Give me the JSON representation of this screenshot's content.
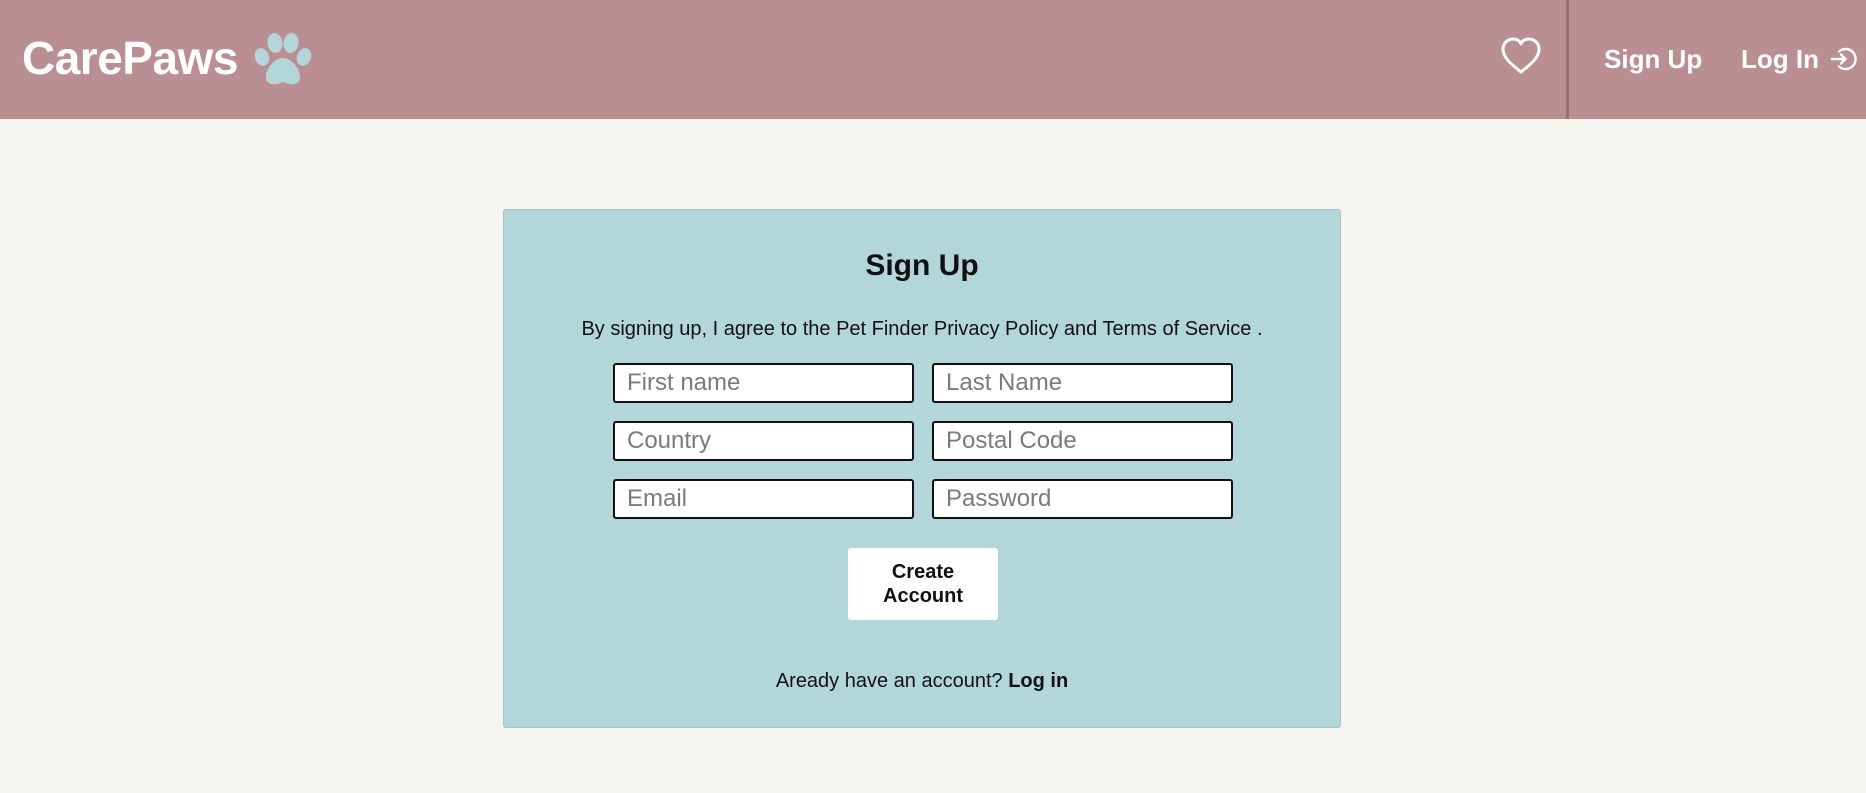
{
  "header": {
    "brand": "CarePaws",
    "nav": {
      "signup_label": "Sign Up",
      "login_label": "Log In"
    }
  },
  "icons": {
    "brand": "paw-icon",
    "favorites": "heart-icon",
    "login": "login-icon"
  },
  "colors": {
    "header_bg": "#ba8f94",
    "page_bg": "#f6f5f1",
    "card_bg": "#b3d6d8",
    "paw": "#b3d6d8"
  },
  "form": {
    "title": "Sign Up",
    "agreement": "By signing up, I agree to the Pet Finder Privacy Policy and Terms of Service .",
    "fields": {
      "first_name": {
        "placeholder": "First name",
        "value": ""
      },
      "last_name": {
        "placeholder": "Last Name",
        "value": ""
      },
      "country": {
        "placeholder": "Country",
        "value": ""
      },
      "postal_code": {
        "placeholder": "Postal Code",
        "value": ""
      },
      "email": {
        "placeholder": "Email",
        "value": ""
      },
      "password": {
        "placeholder": "Password",
        "value": ""
      }
    },
    "submit_label": "Create Account",
    "login_prompt": "Aready have an account?",
    "login_link": "Log in"
  }
}
